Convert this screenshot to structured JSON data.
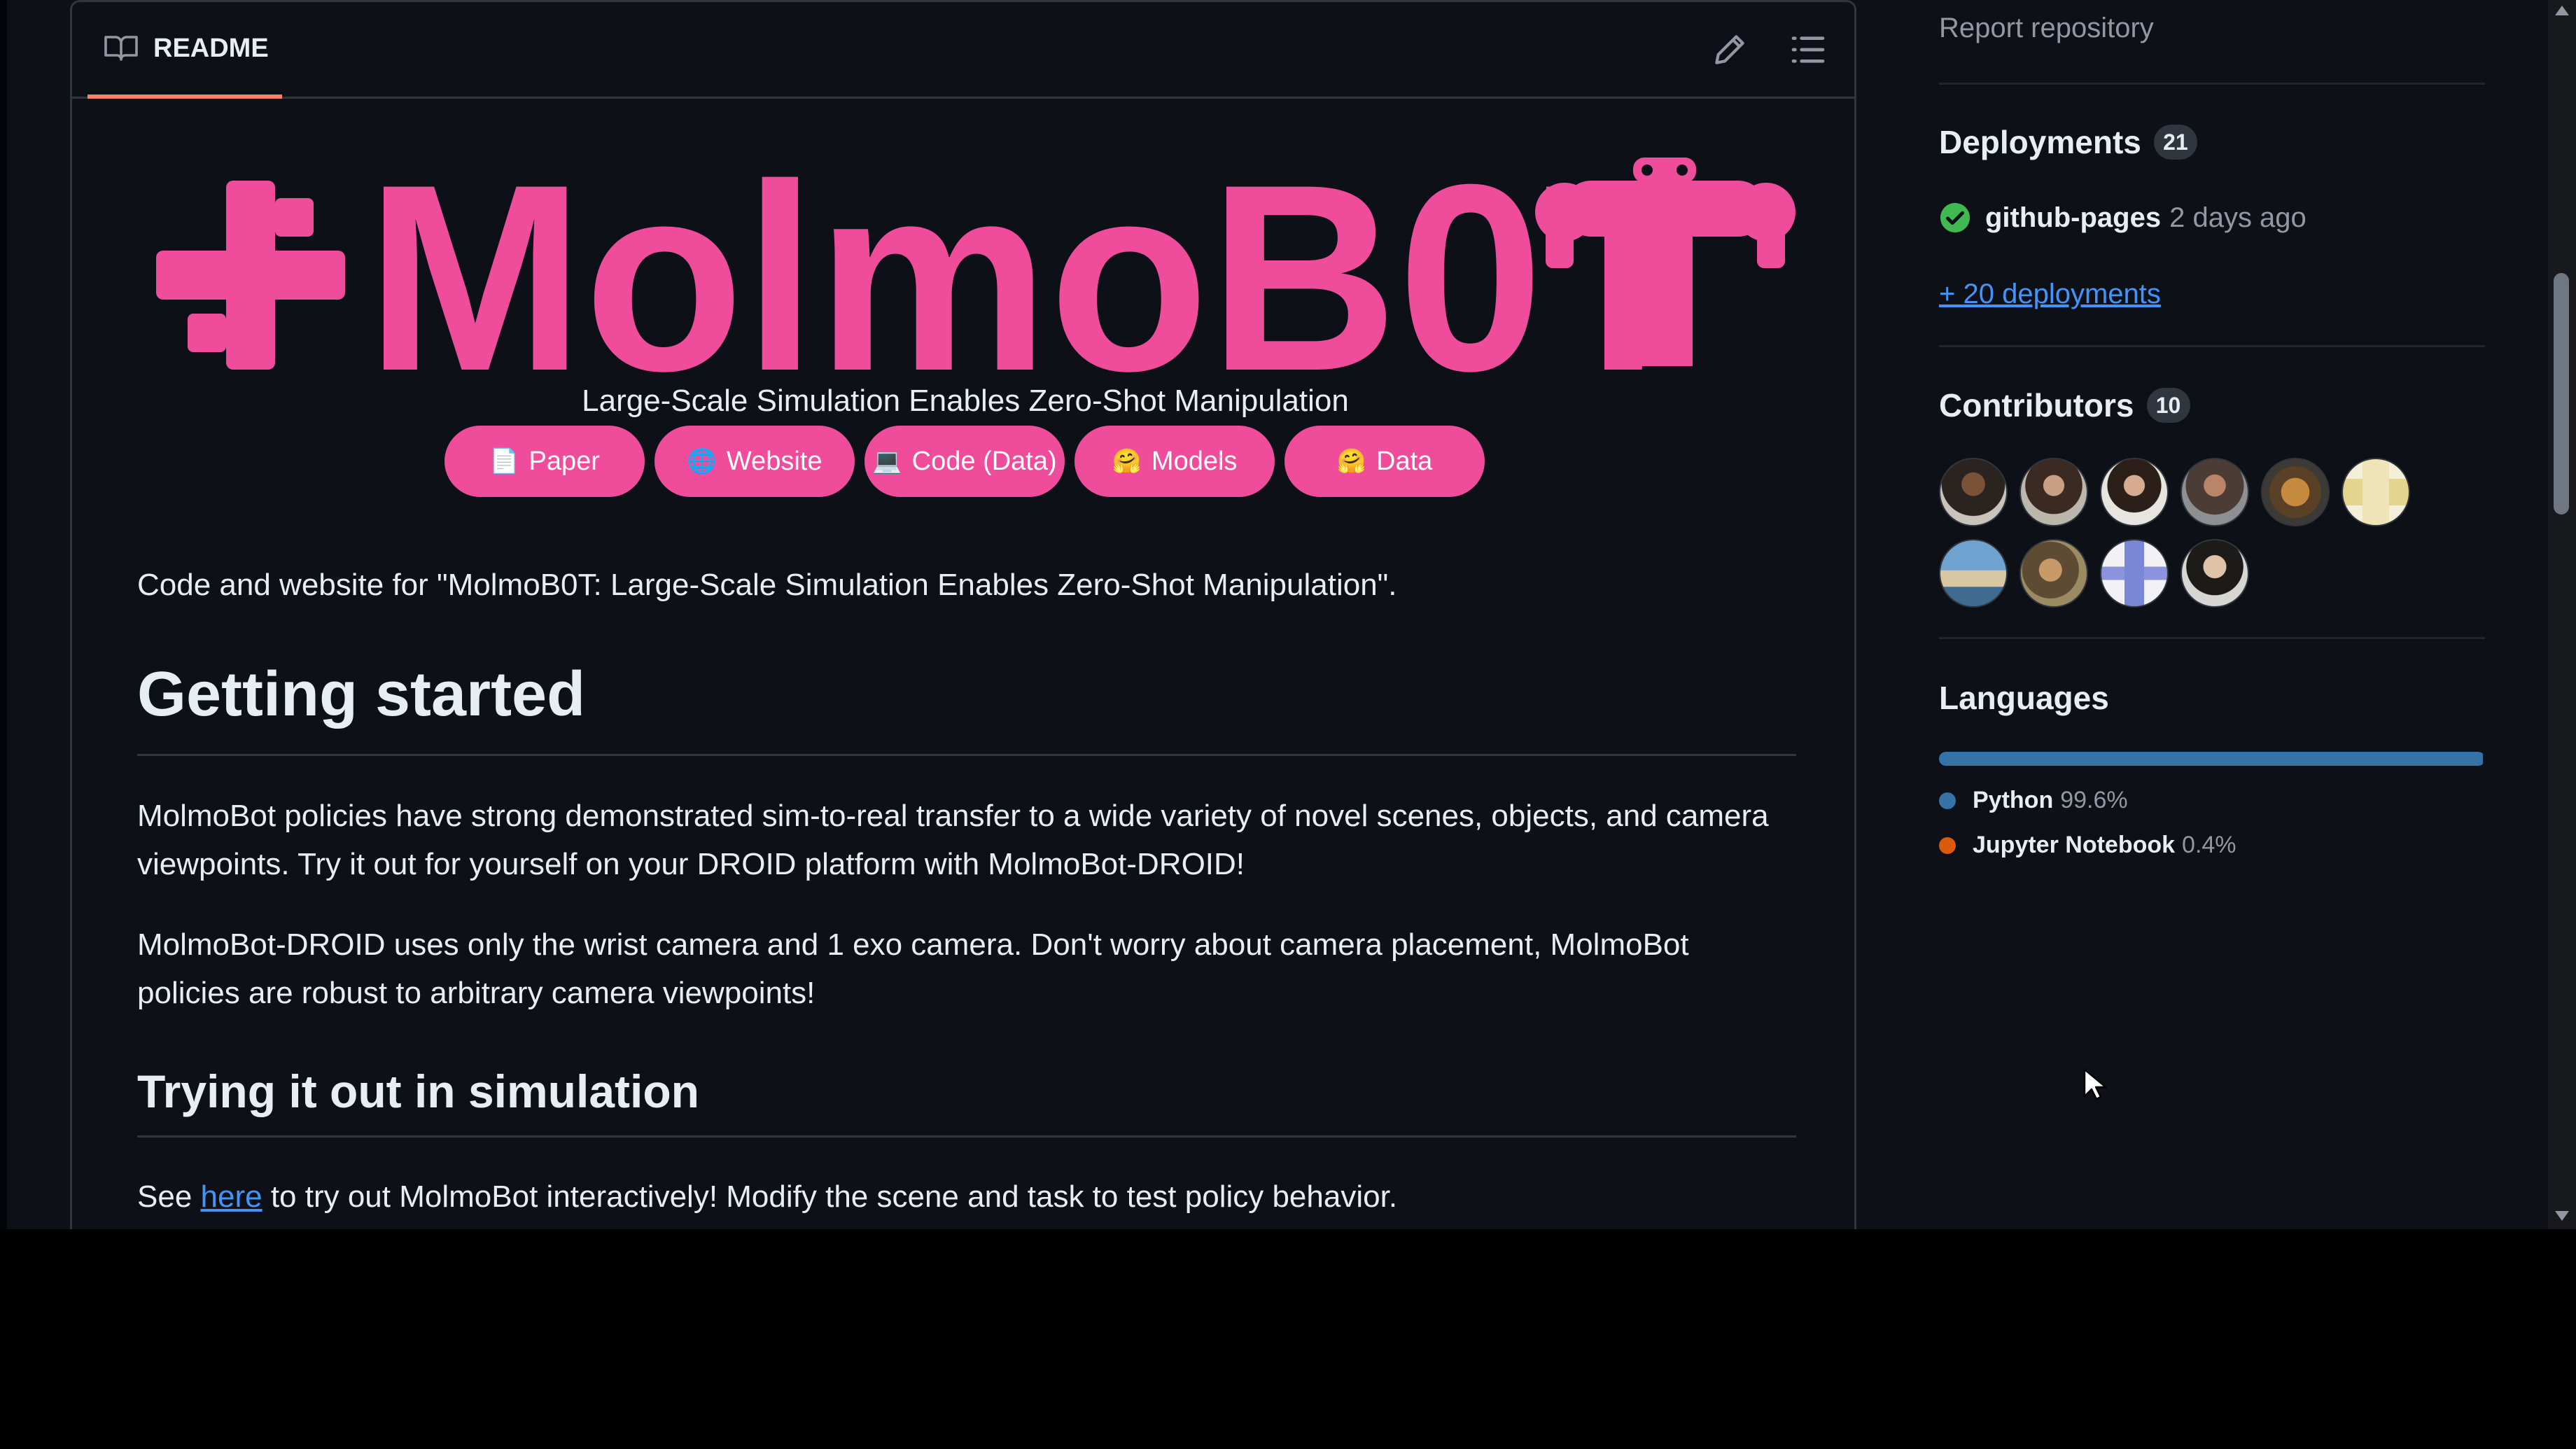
{
  "readme": {
    "tab_label": "README",
    "banner_text": "MolmoB0T",
    "subtitle": "Large-Scale Simulation Enables Zero-Shot Manipulation",
    "badges": [
      {
        "label": "Paper",
        "icon": "page-facing-up-emoji"
      },
      {
        "label": "Website",
        "icon": "globe-emoji"
      },
      {
        "label": "Code (Data)",
        "icon": "laptop-emoji"
      },
      {
        "label": "Models",
        "icon": "hugging-face-emoji"
      },
      {
        "label": "Data",
        "icon": "hugging-face-emoji"
      }
    ],
    "intro": "Code and website for \"MolmoB0T: Large-Scale Simulation Enables Zero-Shot Manipulation\".",
    "getting_started_heading": "Getting started",
    "para1": "MolmoBot policies have strong demonstrated sim-to-real transfer to a wide variety of novel scenes, objects, and camera viewpoints. Try it out for yourself on your DROID platform with MolmoBot-DROID!",
    "para2": "MolmoBot-DROID uses only the wrist camera and 1 exo camera. Don't worry about camera placement, MolmoBot policies are robust to arbitrary camera viewpoints!",
    "simulation_heading": "Trying it out in simulation",
    "see_prefix": "See ",
    "see_link": "here",
    "see_suffix": " to try out MolmoBot interactively! Modify the scene and task to test policy behavior."
  },
  "sidebar": {
    "report_repository": "Report repository",
    "deployments": {
      "title": "Deployments",
      "count": "21",
      "env_name": "github-pages",
      "env_time": "2 days ago",
      "more_link": "+ 20 deployments"
    },
    "contributors": {
      "title": "Contributors",
      "count": "10"
    },
    "languages": {
      "title": "Languages",
      "items": [
        {
          "name": "Python",
          "percent": "99.6%",
          "color": "#3572A5",
          "fraction": 0.996
        },
        {
          "name": "Jupyter Notebook",
          "percent": "0.4%",
          "color": "#DA5B0B",
          "fraction": 0.004
        }
      ]
    }
  },
  "colors": {
    "brand_pink": "#ef4d9c",
    "link_blue": "#4493f8",
    "success_green": "#3fb950"
  }
}
